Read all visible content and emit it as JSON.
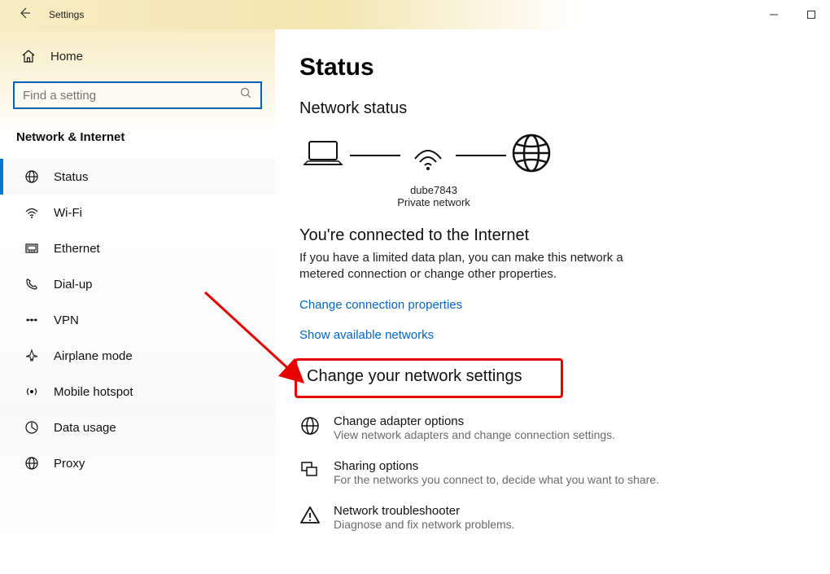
{
  "titlebar": {
    "title": "Settings"
  },
  "sidebar": {
    "home_label": "Home",
    "search_placeholder": "Find a setting",
    "category_label": "Network & Internet",
    "items": [
      {
        "label": "Status"
      },
      {
        "label": "Wi-Fi"
      },
      {
        "label": "Ethernet"
      },
      {
        "label": "Dial-up"
      },
      {
        "label": "VPN"
      },
      {
        "label": "Airplane mode"
      },
      {
        "label": "Mobile hotspot"
      },
      {
        "label": "Data usage"
      },
      {
        "label": "Proxy"
      }
    ]
  },
  "main": {
    "page_title": "Status",
    "network_status_heading": "Network status",
    "network_name": "dube7843",
    "network_type": "Private network",
    "connected_heading": "You're connected to the Internet",
    "connected_body": "If you have a limited data plan, you can make this network a metered connection or change other properties.",
    "change_props_link": "Change connection properties",
    "show_networks_link": "Show available networks",
    "change_settings_heading": "Change your network settings",
    "options": [
      {
        "title": "Change adapter options",
        "desc": "View network adapters and change connection settings."
      },
      {
        "title": "Sharing options",
        "desc": "For the networks you connect to, decide what you want to share."
      },
      {
        "title": "Network troubleshooter",
        "desc": "Diagnose and fix network problems."
      }
    ]
  }
}
